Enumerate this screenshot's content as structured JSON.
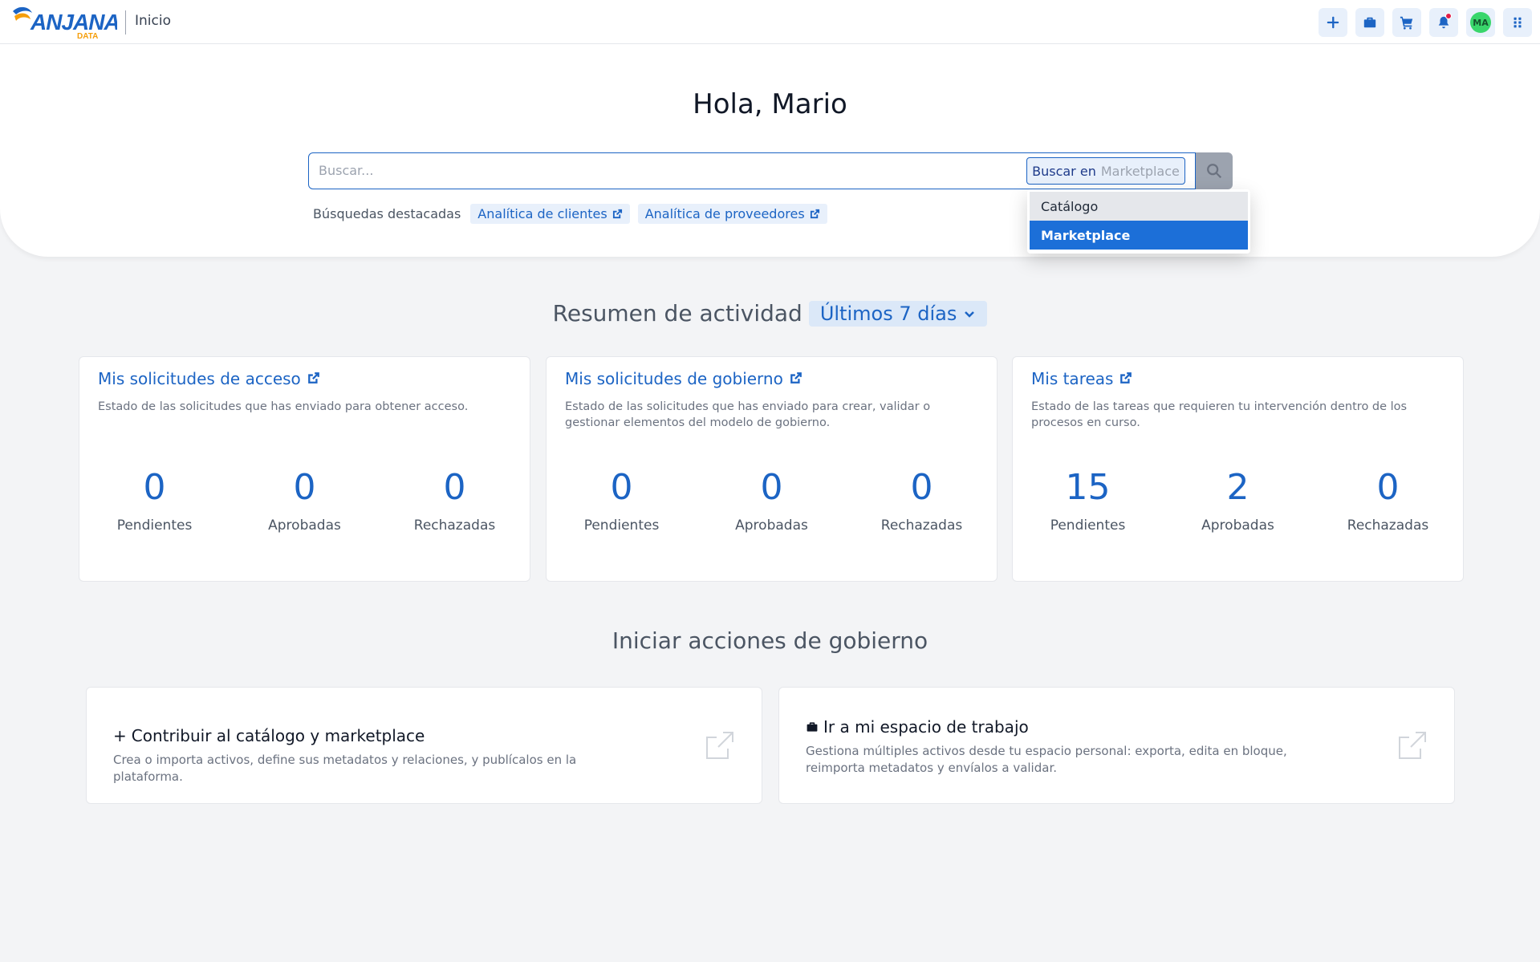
{
  "header": {
    "logo_text": "ANJANA",
    "logo_subtext": "DATA",
    "breadcrumb": "Inicio",
    "avatar_initials": "MA",
    "actions": [
      {
        "icon": "plus-icon"
      },
      {
        "icon": "briefcase-icon"
      },
      {
        "icon": "cart-icon"
      },
      {
        "icon": "bell-icon"
      },
      {
        "icon": "avatar"
      },
      {
        "icon": "apps-grid-icon"
      }
    ]
  },
  "hero": {
    "greeting": "Hola, Mario",
    "search": {
      "placeholder": "Buscar...",
      "value": "",
      "scope_label": "Buscar en",
      "scope_value": "Marketplace"
    },
    "featured_label": "Búsquedas destacadas",
    "featured": [
      "Analítica de clientes",
      "Analítica de proveedores"
    ]
  },
  "scope_dropdown": {
    "options": [
      "Catálogo",
      "Marketplace"
    ],
    "selected": "Marketplace"
  },
  "activity": {
    "title": "Resumen de actividad",
    "period": "Últimos 7 días",
    "cards": [
      {
        "title": "Mis solicitudes de acceso",
        "description": "Estado de las solicitudes que has enviado para obtener acceso.",
        "stats": [
          {
            "value": "0",
            "label": "Pendientes"
          },
          {
            "value": "0",
            "label": "Aprobadas"
          },
          {
            "value": "0",
            "label": "Rechazadas"
          }
        ]
      },
      {
        "title": "Mis solicitudes de gobierno",
        "description": "Estado de las solicitudes que has enviado para crear, validar o gestionar elementos del modelo de gobierno.",
        "stats": [
          {
            "value": "0",
            "label": "Pendientes"
          },
          {
            "value": "0",
            "label": "Aprobadas"
          },
          {
            "value": "0",
            "label": "Rechazadas"
          }
        ]
      },
      {
        "title": "Mis tareas",
        "description": "Estado de las tareas que requieren tu intervención dentro de los procesos en curso.",
        "stats": [
          {
            "value": "15",
            "label": "Pendientes"
          },
          {
            "value": "2",
            "label": "Aprobadas"
          },
          {
            "value": "0",
            "label": "Rechazadas"
          }
        ]
      }
    ]
  },
  "governance": {
    "title": "Iniciar acciones de gobierno",
    "actions": [
      {
        "prefix": "+",
        "icon": "plus-icon",
        "title": "Contribuir al catálogo y marketplace",
        "description": "Crea o importa activos, define sus metadatos y relaciones, y publícalos en la plataforma."
      },
      {
        "prefix": "",
        "icon": "briefcase-icon",
        "title": "Ir a mi espacio de trabajo",
        "description": "Gestiona múltiples activos desde tu espacio personal: exporta, edita en bloque, reimporta metadatos y envíalos a validar."
      }
    ]
  },
  "colors": {
    "primary": "#1c64c4",
    "selected_option": "#1c6fd8",
    "notification_dot": "#e11d48",
    "avatar_bg": "#39d66b"
  }
}
